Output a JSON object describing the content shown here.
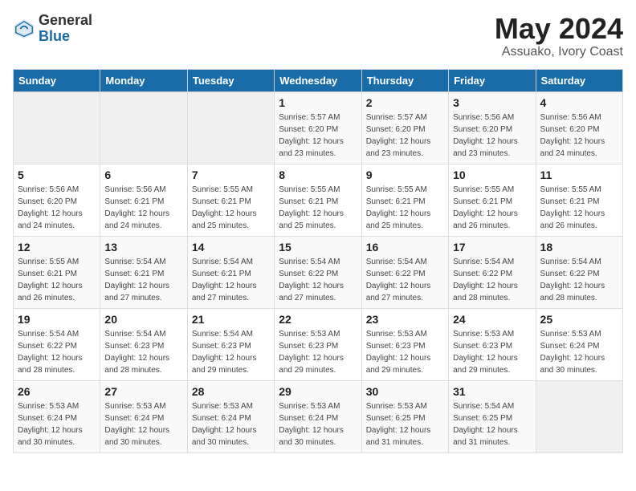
{
  "header": {
    "logo_general": "General",
    "logo_blue": "Blue",
    "month": "May 2024",
    "location": "Assuako, Ivory Coast"
  },
  "weekdays": [
    "Sunday",
    "Monday",
    "Tuesday",
    "Wednesday",
    "Thursday",
    "Friday",
    "Saturday"
  ],
  "weeks": [
    [
      {
        "day": "",
        "info": ""
      },
      {
        "day": "",
        "info": ""
      },
      {
        "day": "",
        "info": ""
      },
      {
        "day": "1",
        "info": "Sunrise: 5:57 AM\nSunset: 6:20 PM\nDaylight: 12 hours\nand 23 minutes."
      },
      {
        "day": "2",
        "info": "Sunrise: 5:57 AM\nSunset: 6:20 PM\nDaylight: 12 hours\nand 23 minutes."
      },
      {
        "day": "3",
        "info": "Sunrise: 5:56 AM\nSunset: 6:20 PM\nDaylight: 12 hours\nand 23 minutes."
      },
      {
        "day": "4",
        "info": "Sunrise: 5:56 AM\nSunset: 6:20 PM\nDaylight: 12 hours\nand 24 minutes."
      }
    ],
    [
      {
        "day": "5",
        "info": "Sunrise: 5:56 AM\nSunset: 6:20 PM\nDaylight: 12 hours\nand 24 minutes."
      },
      {
        "day": "6",
        "info": "Sunrise: 5:56 AM\nSunset: 6:21 PM\nDaylight: 12 hours\nand 24 minutes."
      },
      {
        "day": "7",
        "info": "Sunrise: 5:55 AM\nSunset: 6:21 PM\nDaylight: 12 hours\nand 25 minutes."
      },
      {
        "day": "8",
        "info": "Sunrise: 5:55 AM\nSunset: 6:21 PM\nDaylight: 12 hours\nand 25 minutes."
      },
      {
        "day": "9",
        "info": "Sunrise: 5:55 AM\nSunset: 6:21 PM\nDaylight: 12 hours\nand 25 minutes."
      },
      {
        "day": "10",
        "info": "Sunrise: 5:55 AM\nSunset: 6:21 PM\nDaylight: 12 hours\nand 26 minutes."
      },
      {
        "day": "11",
        "info": "Sunrise: 5:55 AM\nSunset: 6:21 PM\nDaylight: 12 hours\nand 26 minutes."
      }
    ],
    [
      {
        "day": "12",
        "info": "Sunrise: 5:55 AM\nSunset: 6:21 PM\nDaylight: 12 hours\nand 26 minutes."
      },
      {
        "day": "13",
        "info": "Sunrise: 5:54 AM\nSunset: 6:21 PM\nDaylight: 12 hours\nand 27 minutes."
      },
      {
        "day": "14",
        "info": "Sunrise: 5:54 AM\nSunset: 6:21 PM\nDaylight: 12 hours\nand 27 minutes."
      },
      {
        "day": "15",
        "info": "Sunrise: 5:54 AM\nSunset: 6:22 PM\nDaylight: 12 hours\nand 27 minutes."
      },
      {
        "day": "16",
        "info": "Sunrise: 5:54 AM\nSunset: 6:22 PM\nDaylight: 12 hours\nand 27 minutes."
      },
      {
        "day": "17",
        "info": "Sunrise: 5:54 AM\nSunset: 6:22 PM\nDaylight: 12 hours\nand 28 minutes."
      },
      {
        "day": "18",
        "info": "Sunrise: 5:54 AM\nSunset: 6:22 PM\nDaylight: 12 hours\nand 28 minutes."
      }
    ],
    [
      {
        "day": "19",
        "info": "Sunrise: 5:54 AM\nSunset: 6:22 PM\nDaylight: 12 hours\nand 28 minutes."
      },
      {
        "day": "20",
        "info": "Sunrise: 5:54 AM\nSunset: 6:23 PM\nDaylight: 12 hours\nand 28 minutes."
      },
      {
        "day": "21",
        "info": "Sunrise: 5:54 AM\nSunset: 6:23 PM\nDaylight: 12 hours\nand 29 minutes."
      },
      {
        "day": "22",
        "info": "Sunrise: 5:53 AM\nSunset: 6:23 PM\nDaylight: 12 hours\nand 29 minutes."
      },
      {
        "day": "23",
        "info": "Sunrise: 5:53 AM\nSunset: 6:23 PM\nDaylight: 12 hours\nand 29 minutes."
      },
      {
        "day": "24",
        "info": "Sunrise: 5:53 AM\nSunset: 6:23 PM\nDaylight: 12 hours\nand 29 minutes."
      },
      {
        "day": "25",
        "info": "Sunrise: 5:53 AM\nSunset: 6:24 PM\nDaylight: 12 hours\nand 30 minutes."
      }
    ],
    [
      {
        "day": "26",
        "info": "Sunrise: 5:53 AM\nSunset: 6:24 PM\nDaylight: 12 hours\nand 30 minutes."
      },
      {
        "day": "27",
        "info": "Sunrise: 5:53 AM\nSunset: 6:24 PM\nDaylight: 12 hours\nand 30 minutes."
      },
      {
        "day": "28",
        "info": "Sunrise: 5:53 AM\nSunset: 6:24 PM\nDaylight: 12 hours\nand 30 minutes."
      },
      {
        "day": "29",
        "info": "Sunrise: 5:53 AM\nSunset: 6:24 PM\nDaylight: 12 hours\nand 30 minutes."
      },
      {
        "day": "30",
        "info": "Sunrise: 5:53 AM\nSunset: 6:25 PM\nDaylight: 12 hours\nand 31 minutes."
      },
      {
        "day": "31",
        "info": "Sunrise: 5:54 AM\nSunset: 6:25 PM\nDaylight: 12 hours\nand 31 minutes."
      },
      {
        "day": "",
        "info": ""
      }
    ]
  ]
}
